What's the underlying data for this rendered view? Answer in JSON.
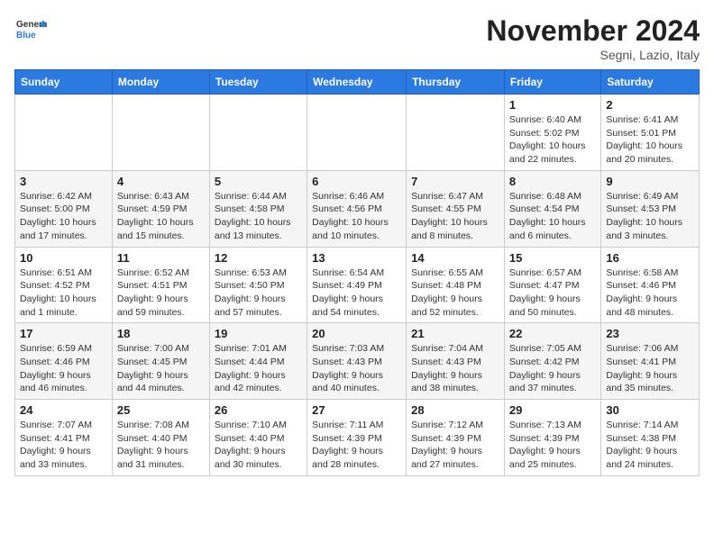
{
  "logo": {
    "line1": "General",
    "line2": "Blue"
  },
  "title": "November 2024",
  "location": "Segni, Lazio, Italy",
  "weekdays": [
    "Sunday",
    "Monday",
    "Tuesday",
    "Wednesday",
    "Thursday",
    "Friday",
    "Saturday"
  ],
  "weeks": [
    [
      {
        "day": "",
        "info": ""
      },
      {
        "day": "",
        "info": ""
      },
      {
        "day": "",
        "info": ""
      },
      {
        "day": "",
        "info": ""
      },
      {
        "day": "",
        "info": ""
      },
      {
        "day": "1",
        "info": "Sunrise: 6:40 AM\nSunset: 5:02 PM\nDaylight: 10 hours and 22 minutes."
      },
      {
        "day": "2",
        "info": "Sunrise: 6:41 AM\nSunset: 5:01 PM\nDaylight: 10 hours and 20 minutes."
      }
    ],
    [
      {
        "day": "3",
        "info": "Sunrise: 6:42 AM\nSunset: 5:00 PM\nDaylight: 10 hours and 17 minutes."
      },
      {
        "day": "4",
        "info": "Sunrise: 6:43 AM\nSunset: 4:59 PM\nDaylight: 10 hours and 15 minutes."
      },
      {
        "day": "5",
        "info": "Sunrise: 6:44 AM\nSunset: 4:58 PM\nDaylight: 10 hours and 13 minutes."
      },
      {
        "day": "6",
        "info": "Sunrise: 6:46 AM\nSunset: 4:56 PM\nDaylight: 10 hours and 10 minutes."
      },
      {
        "day": "7",
        "info": "Sunrise: 6:47 AM\nSunset: 4:55 PM\nDaylight: 10 hours and 8 minutes."
      },
      {
        "day": "8",
        "info": "Sunrise: 6:48 AM\nSunset: 4:54 PM\nDaylight: 10 hours and 6 minutes."
      },
      {
        "day": "9",
        "info": "Sunrise: 6:49 AM\nSunset: 4:53 PM\nDaylight: 10 hours and 3 minutes."
      }
    ],
    [
      {
        "day": "10",
        "info": "Sunrise: 6:51 AM\nSunset: 4:52 PM\nDaylight: 10 hours and 1 minute."
      },
      {
        "day": "11",
        "info": "Sunrise: 6:52 AM\nSunset: 4:51 PM\nDaylight: 9 hours and 59 minutes."
      },
      {
        "day": "12",
        "info": "Sunrise: 6:53 AM\nSunset: 4:50 PM\nDaylight: 9 hours and 57 minutes."
      },
      {
        "day": "13",
        "info": "Sunrise: 6:54 AM\nSunset: 4:49 PM\nDaylight: 9 hours and 54 minutes."
      },
      {
        "day": "14",
        "info": "Sunrise: 6:55 AM\nSunset: 4:48 PM\nDaylight: 9 hours and 52 minutes."
      },
      {
        "day": "15",
        "info": "Sunrise: 6:57 AM\nSunset: 4:47 PM\nDaylight: 9 hours and 50 minutes."
      },
      {
        "day": "16",
        "info": "Sunrise: 6:58 AM\nSunset: 4:46 PM\nDaylight: 9 hours and 48 minutes."
      }
    ],
    [
      {
        "day": "17",
        "info": "Sunrise: 6:59 AM\nSunset: 4:46 PM\nDaylight: 9 hours and 46 minutes."
      },
      {
        "day": "18",
        "info": "Sunrise: 7:00 AM\nSunset: 4:45 PM\nDaylight: 9 hours and 44 minutes."
      },
      {
        "day": "19",
        "info": "Sunrise: 7:01 AM\nSunset: 4:44 PM\nDaylight: 9 hours and 42 minutes."
      },
      {
        "day": "20",
        "info": "Sunrise: 7:03 AM\nSunset: 4:43 PM\nDaylight: 9 hours and 40 minutes."
      },
      {
        "day": "21",
        "info": "Sunrise: 7:04 AM\nSunset: 4:43 PM\nDaylight: 9 hours and 38 minutes."
      },
      {
        "day": "22",
        "info": "Sunrise: 7:05 AM\nSunset: 4:42 PM\nDaylight: 9 hours and 37 minutes."
      },
      {
        "day": "23",
        "info": "Sunrise: 7:06 AM\nSunset: 4:41 PM\nDaylight: 9 hours and 35 minutes."
      }
    ],
    [
      {
        "day": "24",
        "info": "Sunrise: 7:07 AM\nSunset: 4:41 PM\nDaylight: 9 hours and 33 minutes."
      },
      {
        "day": "25",
        "info": "Sunrise: 7:08 AM\nSunset: 4:40 PM\nDaylight: 9 hours and 31 minutes."
      },
      {
        "day": "26",
        "info": "Sunrise: 7:10 AM\nSunset: 4:40 PM\nDaylight: 9 hours and 30 minutes."
      },
      {
        "day": "27",
        "info": "Sunrise: 7:11 AM\nSunset: 4:39 PM\nDaylight: 9 hours and 28 minutes."
      },
      {
        "day": "28",
        "info": "Sunrise: 7:12 AM\nSunset: 4:39 PM\nDaylight: 9 hours and 27 minutes."
      },
      {
        "day": "29",
        "info": "Sunrise: 7:13 AM\nSunset: 4:39 PM\nDaylight: 9 hours and 25 minutes."
      },
      {
        "day": "30",
        "info": "Sunrise: 7:14 AM\nSunset: 4:38 PM\nDaylight: 9 hours and 24 minutes."
      }
    ]
  ]
}
